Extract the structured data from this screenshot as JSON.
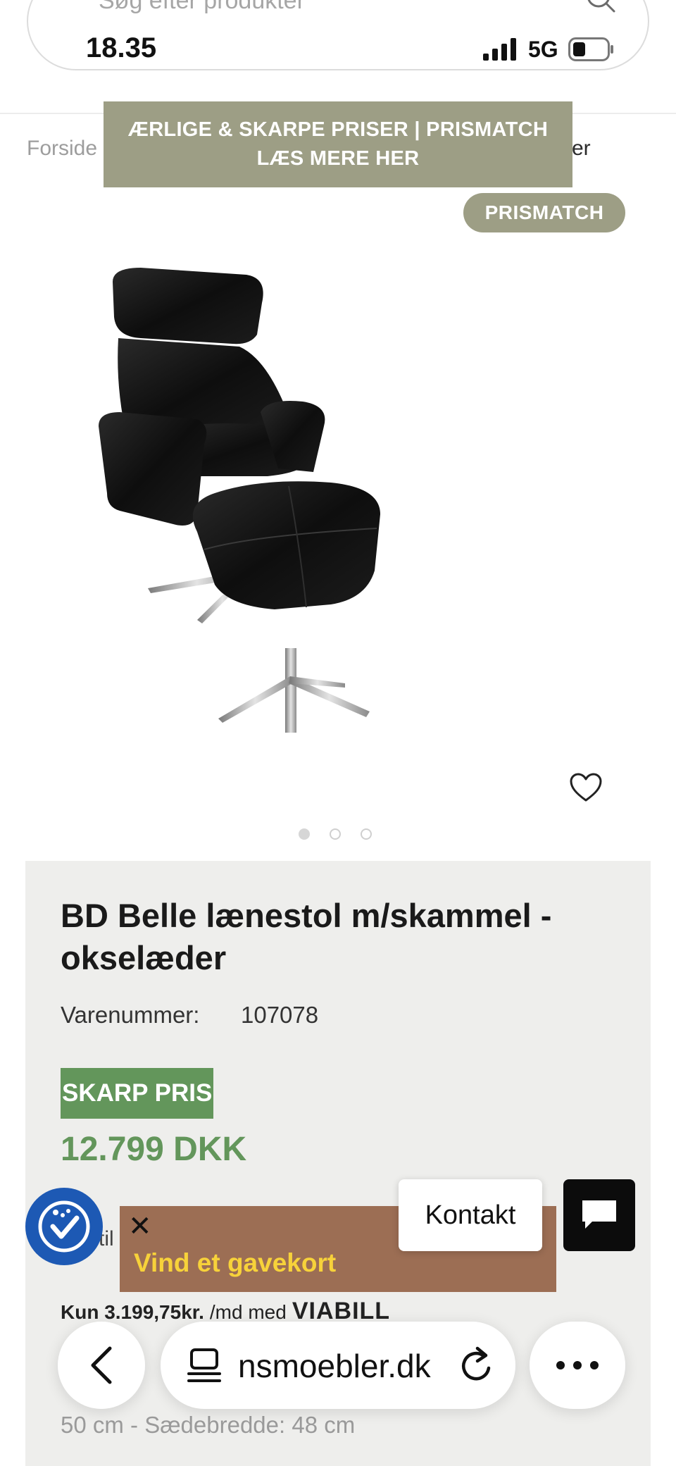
{
  "status_bar": {
    "time": "18.35",
    "network": "5G"
  },
  "header": {
    "search_placeholder": "Søg efter produkter"
  },
  "breadcrumb": {
    "first": "Forside",
    "last_fragment": "er"
  },
  "promo": {
    "line1": "ÆRLIGE & SKARPE PRISER | PRISMATCH",
    "line2": "LÆS MERE HER"
  },
  "badge": {
    "prismatch": "PRISMATCH"
  },
  "product": {
    "title": "BD Belle lænestol m/skammel - okselæder",
    "sku_label": "Varenummer:",
    "sku": "107078",
    "price_badge": "SKARP PRIS",
    "price": "12.799 DKK",
    "partial_text": "til",
    "financing_amount": "Kun 3.199,75kr.",
    "financing_suffix": "/md med",
    "financing_brand": "VIABILL",
    "dimensions_line": "50 cm - Sædebredde: 48 cm"
  },
  "carousel": {
    "count": 3,
    "active": 0
  },
  "gift": {
    "close": "✕",
    "text": "Vind et gavekort"
  },
  "contact": {
    "label": "Kontakt"
  },
  "browser": {
    "url": "nsmoebler.dk"
  },
  "colors": {
    "accent": "#9d9e85",
    "price_green": "#63965b",
    "gift_bg": "#9c6e54",
    "gift_text": "#f7d23a",
    "a11y_blue": "#1d59b4"
  }
}
